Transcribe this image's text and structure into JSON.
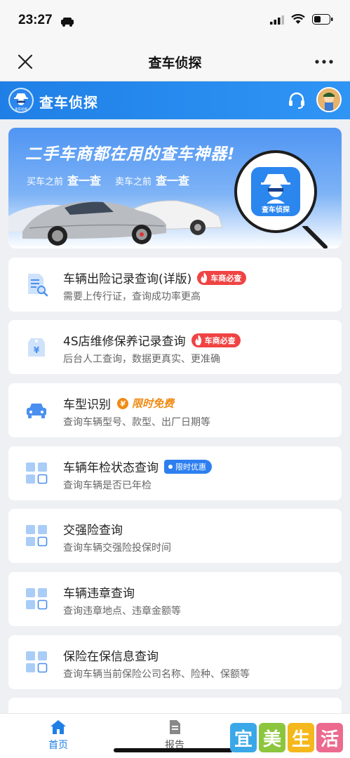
{
  "status": {
    "time": "23:27"
  },
  "nav": {
    "title": "查车侦探"
  },
  "header": {
    "app_name": "查车侦探",
    "logo_text": "查车侦探"
  },
  "banner": {
    "title": "二手车商都在用的查车神器!",
    "buy_prefix": "买车之前",
    "buy_action": "查一查",
    "sell_prefix": "卖车之前",
    "sell_action": "查一查",
    "badge_label": "查车侦探"
  },
  "services": [
    {
      "title": "车辆出险记录查询(详版)",
      "desc": "需要上传行证，查询成功率更高",
      "badge": "车商必查",
      "badge_type": "hot",
      "icon": "document-search-icon"
    },
    {
      "title": "4S店维修保养记录查询",
      "desc": "后台人工查询，数据更真实、更准确",
      "badge": "车商必查",
      "badge_type": "hot",
      "icon": "price-tag-icon"
    },
    {
      "title": "车型识别",
      "desc": "查询车辆型号、款型、出厂日期等",
      "badge": "限时免费",
      "badge_type": "free",
      "icon": "car-icon"
    },
    {
      "title": "车辆年检状态查询",
      "desc": "查询车辆是否已年检",
      "badge": "限时优惠",
      "badge_type": "offer",
      "icon": "grid-icon"
    },
    {
      "title": "交强险查询",
      "desc": "查询车辆交强险投保时间",
      "badge": "",
      "badge_type": "",
      "icon": "grid-icon"
    },
    {
      "title": "车辆违章查询",
      "desc": "查询违章地点、违章金额等",
      "badge": "",
      "badge_type": "",
      "icon": "grid-icon"
    },
    {
      "title": "保险在保信息查询",
      "desc": "查询车辆当前保险公司名称、险种、保额等",
      "badge": "",
      "badge_type": "",
      "icon": "grid-icon"
    }
  ],
  "tabs": [
    {
      "label": "首页",
      "icon": "home-icon",
      "active": true
    },
    {
      "label": "报告",
      "icon": "report-icon",
      "active": false
    }
  ],
  "watermark": {
    "chars": [
      "宜",
      "美",
      "生",
      "活"
    ]
  },
  "colors": {
    "primary": "#1f7fe6",
    "hot": "#f04343",
    "free": "#f08a12",
    "offer": "#2d7ff0"
  }
}
